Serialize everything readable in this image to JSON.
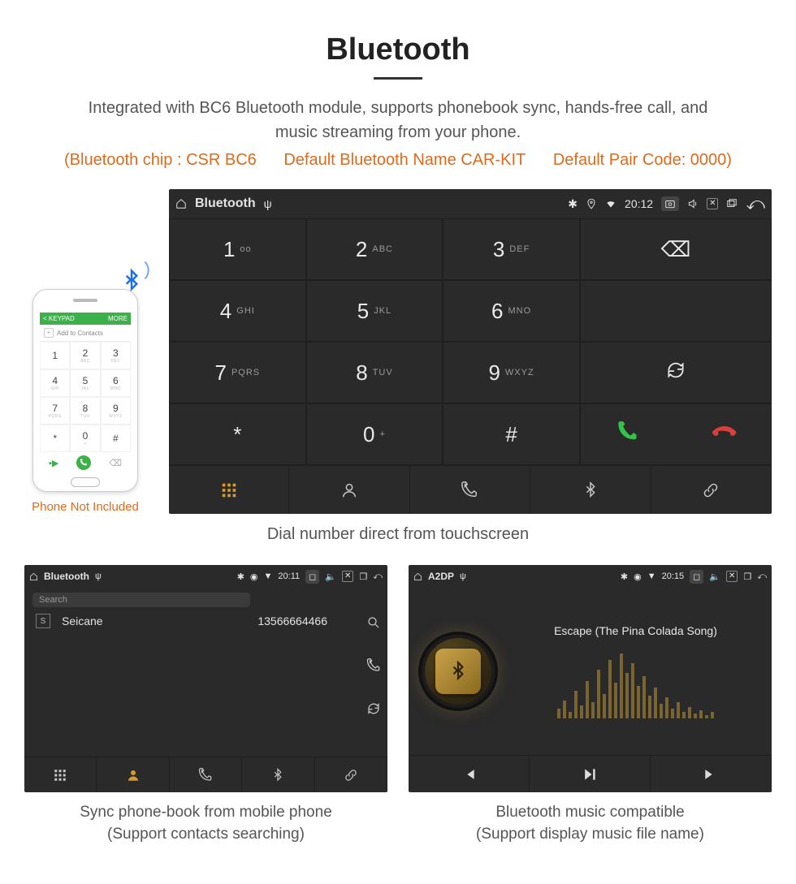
{
  "header": {
    "title": "Bluetooth",
    "subtitle": "Integrated with BC6 Bluetooth module, supports phonebook sync, hands-free call, and music streaming from your phone.",
    "spec_chip": "(Bluetooth chip : CSR BC6",
    "spec_name": "Default Bluetooth Name CAR-KIT",
    "spec_pair": "Default Pair Code: 0000)"
  },
  "phone": {
    "top_left": "< KEYPAD",
    "top_right": "MORE",
    "add_contacts": "Add to Contacts",
    "keys": [
      {
        "n": "1",
        "s": ""
      },
      {
        "n": "2",
        "s": "ABC"
      },
      {
        "n": "3",
        "s": "DEF"
      },
      {
        "n": "4",
        "s": "GHI"
      },
      {
        "n": "5",
        "s": "JKL"
      },
      {
        "n": "6",
        "s": "MNO"
      },
      {
        "n": "7",
        "s": "PQRS"
      },
      {
        "n": "8",
        "s": "TUV"
      },
      {
        "n": "9",
        "s": "WXYZ"
      },
      {
        "n": "*",
        "s": ""
      },
      {
        "n": "0",
        "s": "+"
      },
      {
        "n": "#",
        "s": ""
      }
    ],
    "caption": "Phone Not Included"
  },
  "dialer": {
    "status": {
      "title": "Bluetooth",
      "time": "20:12"
    },
    "keys": [
      {
        "n": "1",
        "s": "oo"
      },
      {
        "n": "2",
        "s": "ABC"
      },
      {
        "n": "3",
        "s": "DEF"
      },
      {
        "n": "4",
        "s": "GHI"
      },
      {
        "n": "5",
        "s": "JKL"
      },
      {
        "n": "6",
        "s": "MNO"
      },
      {
        "n": "7",
        "s": "PQRS"
      },
      {
        "n": "8",
        "s": "TUV"
      },
      {
        "n": "9",
        "s": "WXYZ"
      },
      {
        "n": "*",
        "s": ""
      },
      {
        "n": "0",
        "s": "+"
      },
      {
        "n": "#",
        "s": ""
      }
    ],
    "caption": "Dial number direct from touchscreen"
  },
  "contacts": {
    "status": {
      "title": "Bluetooth",
      "time": "20:11"
    },
    "search_placeholder": "Search",
    "item": {
      "letter": "S",
      "name": "Seicane",
      "number": "13566664466"
    },
    "caption1": "Sync phone-book from mobile phone",
    "caption2": "(Support contacts searching)"
  },
  "music": {
    "status": {
      "title": "A2DP",
      "time": "20:15"
    },
    "track": "Escape (The Pina Colada Song)",
    "eq_heights": [
      12,
      22,
      8,
      34,
      16,
      46,
      20,
      60,
      30,
      72,
      44,
      80,
      56,
      68,
      40,
      52,
      28,
      38,
      18,
      26,
      12,
      20,
      8,
      14,
      6,
      10,
      4,
      8
    ],
    "caption1": "Bluetooth music compatible",
    "caption2": "(Support display music file name)"
  }
}
